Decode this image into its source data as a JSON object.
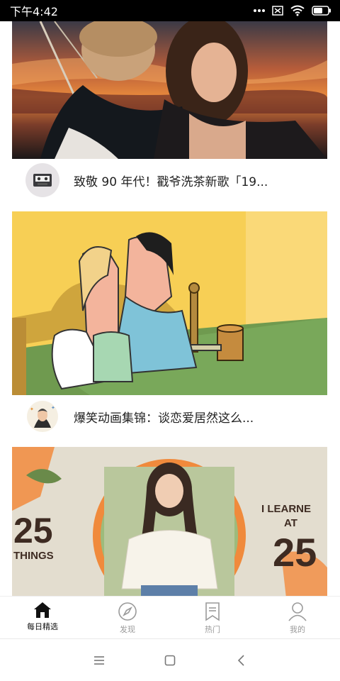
{
  "status_bar": {
    "time": "下午4:42",
    "icons": [
      "dots-icon",
      "sim-off-icon",
      "wifi-icon",
      "battery-icon"
    ]
  },
  "feed": {
    "cards": [
      {
        "image": "titanic-pose-photo",
        "avatar": "cassette-avatar",
        "title": "致敬 90 年代！戳爷洗茶新歌「19..."
      },
      {
        "image": "cartoon-kiss-illustration",
        "avatar": "cartoon-avatar",
        "title": "爆笑动画集锦：谈恋爱居然这么..."
      },
      {
        "image": "25-things-thumbnail",
        "overlay_text_left_number": "25",
        "overlay_text_left_word": "THINGS",
        "overlay_text_right_top": "I LEARNE",
        "overlay_text_right_mid": "AT",
        "overlay_text_right_number": "25"
      }
    ]
  },
  "bottom_nav": {
    "items": [
      {
        "label": "每日精选",
        "icon": "home-icon",
        "active": true
      },
      {
        "label": "发现",
        "icon": "compass-icon",
        "active": false
      },
      {
        "label": "热门",
        "icon": "bookmark-icon",
        "active": false
      },
      {
        "label": "我的",
        "icon": "user-icon",
        "active": false
      }
    ]
  },
  "system_nav": {
    "icons": [
      "menu-icon",
      "home-square-icon",
      "back-icon"
    ]
  },
  "colors": {
    "active": "#111111",
    "inactive": "#9a9a9a",
    "accent_orange": "#f08a3c"
  }
}
